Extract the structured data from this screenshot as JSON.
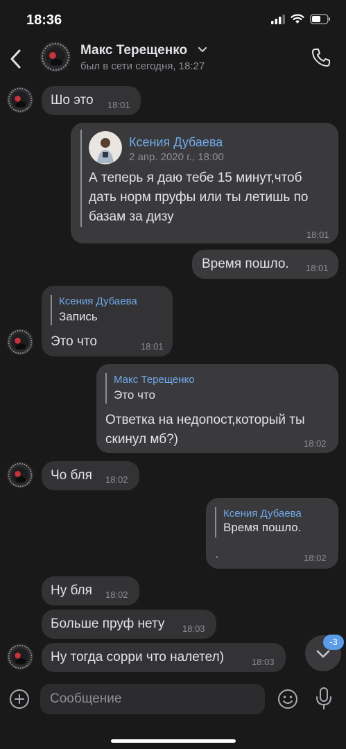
{
  "status_bar": {
    "time": "18:36"
  },
  "header": {
    "name": "Макс Терещенко",
    "status": "был в сети сегодня, 18:27"
  },
  "messages": [
    {
      "text": "Шо это",
      "time": "18:01"
    },
    {
      "forward_name": "Ксения Дубаева",
      "forward_date": "2 апр. 2020 г., 18:00",
      "lines": [
        "А теперь я даю тебе 15 минут,чтоб",
        "дать норм пруфы или ты летишь по",
        "базам за дизу"
      ],
      "time": "18:01"
    },
    {
      "text": "Время пошло.",
      "time": "18:01"
    },
    {
      "reply_name": "Ксения Дубаева",
      "reply_text": "Запись",
      "text": "Это что",
      "time": "18:01"
    },
    {
      "reply_name": "Макс Терещенко",
      "reply_text": "Это что",
      "lines": [
        "Ответка на недопост,который ты",
        "скинул мб?)"
      ],
      "time": "18:02"
    },
    {
      "text": "Чо бля",
      "time": "18:02"
    },
    {
      "reply_name": "Ксения Дубаева",
      "reply_text": "Время пошло.",
      "text": ".",
      "time": "18:02"
    },
    {
      "text": "Ну бля",
      "time": "18:02"
    },
    {
      "text": "Больше пруф нету",
      "time": "18:03"
    },
    {
      "text": "Ну тогда сорри что налетел)",
      "time": "18:03"
    }
  ],
  "scroll_badge": "-3",
  "composer": {
    "placeholder": "Сообщение"
  },
  "colors": {
    "accent": "#71aaeb",
    "badge": "#5a9ce8",
    "bubble": "#333335",
    "background": "#19191a"
  },
  "icons": [
    "back-arrow-icon",
    "chevron-down-icon",
    "phone-icon",
    "add-icon",
    "emoji-icon",
    "mic-icon",
    "chevron-down-icon"
  ]
}
